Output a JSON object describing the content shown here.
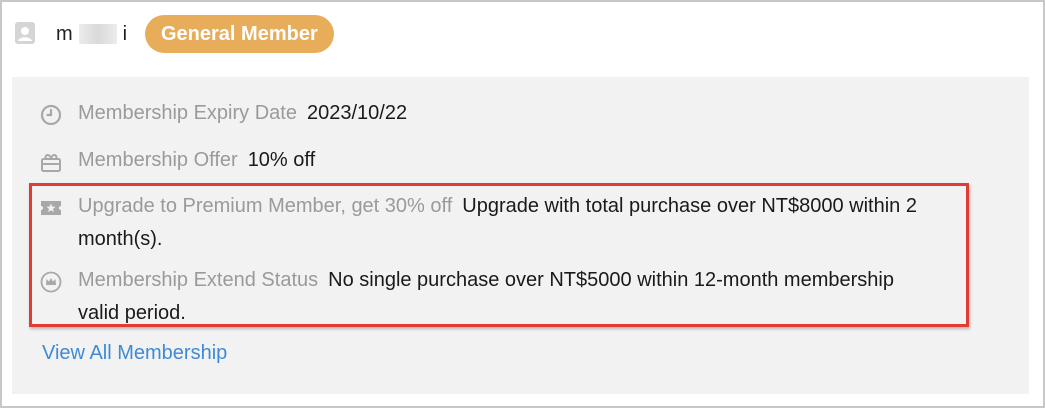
{
  "member": {
    "name_first": "m",
    "name_last": "i",
    "badge": "General Member"
  },
  "details": [
    {
      "icon": "clock-icon",
      "label": "Membership Expiry Date",
      "value": "2023/10/22"
    },
    {
      "icon": "gift-icon",
      "label": "Membership Offer",
      "value": "10% off"
    },
    {
      "icon": "star-ticket-icon",
      "label": "Upgrade to Premium Member, get 30% off",
      "value": "Upgrade with total purchase over NT$8000 within 2 month(s)."
    },
    {
      "icon": "crown-icon",
      "label": "Membership Extend Status",
      "value": "No single purchase over NT$5000 within 12-month membership valid period."
    }
  ],
  "links": {
    "view_all": "View All Membership"
  },
  "colors": {
    "badge_bg": "#e8ad5b",
    "label_gray": "#9a9a9a",
    "link_blue": "#3f8ad6",
    "highlight_red": "#e23b34",
    "panel_bg": "#f2f2f2"
  }
}
